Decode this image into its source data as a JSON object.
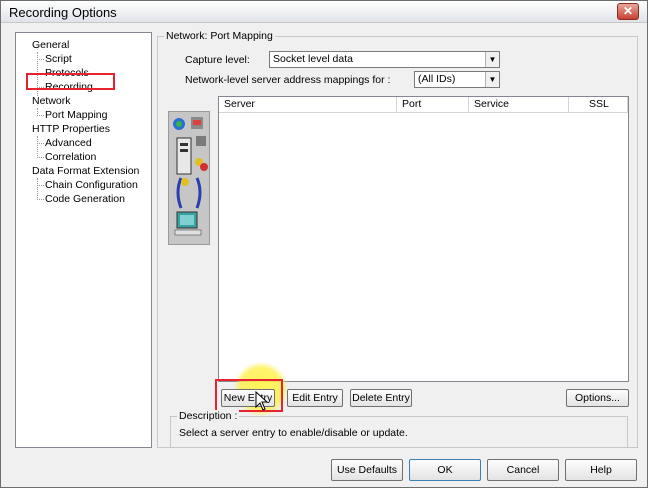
{
  "window": {
    "title": "Recording Options",
    "close_glyph": "✕"
  },
  "tree": {
    "items": [
      {
        "label": "General"
      },
      {
        "label": "Script"
      },
      {
        "label": "Protocols"
      },
      {
        "label": "Recording"
      },
      {
        "label": "Network"
      },
      {
        "label": "Port Mapping"
      },
      {
        "label": "HTTP Properties"
      },
      {
        "label": "Advanced"
      },
      {
        "label": "Correlation"
      },
      {
        "label": "Data Format Extension"
      },
      {
        "label": "Chain Configuration"
      },
      {
        "label": "Code Generation"
      }
    ],
    "selected": "Port Mapping"
  },
  "panel": {
    "group_title": "Network: Port Mapping",
    "capture_level_label": "Capture level:",
    "capture_level_value": "Socket level data",
    "mappings_label": "Network-level server address mappings for :",
    "mappings_value": "(All IDs)",
    "columns": [
      "Server",
      "Port",
      "Service",
      "SSL"
    ],
    "rows": []
  },
  "buttons": {
    "new_entry": "New Entry",
    "edit_entry": "Edit Entry",
    "delete_entry": "Delete Entry",
    "options": "Options...",
    "use_defaults": "Use Defaults",
    "ok": "OK",
    "cancel": "Cancel",
    "help": "Help"
  },
  "description": {
    "label": "Description :",
    "text": "Select a server entry to enable/disable or update."
  },
  "colors": {
    "highlight_red": "#e8232f",
    "cursor_halo": "#fff250"
  }
}
